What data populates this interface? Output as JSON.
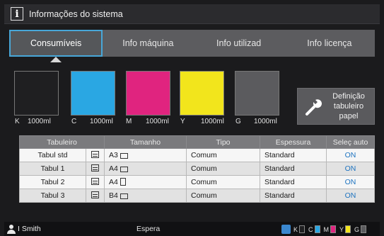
{
  "header": {
    "title": "Informações do sistema",
    "icon": "info-icon"
  },
  "tabs": [
    {
      "label": "Consumíveis",
      "active": true
    },
    {
      "label": "Info máquina",
      "active": false
    },
    {
      "label": "Info utilizad",
      "active": false
    },
    {
      "label": "Info licença",
      "active": false
    }
  ],
  "inks": [
    {
      "letter": "K",
      "amount": "1000ml",
      "color": "#1f1f21"
    },
    {
      "letter": "C",
      "amount": "1000ml",
      "color": "#2aa7e3"
    },
    {
      "letter": "M",
      "amount": "1000ml",
      "color": "#e0247f"
    },
    {
      "letter": "Y",
      "amount": "1000ml",
      "color": "#f2e51c"
    },
    {
      "letter": "G",
      "amount": "1000ml",
      "color": "#5b5b5e"
    }
  ],
  "tray_button": {
    "line1": "Definição",
    "line2": "tabuleiro",
    "line3": "papel",
    "icon": "wrench-icon"
  },
  "table": {
    "headers": [
      "Tabuleiro",
      "Tamanho",
      "Tipo",
      "Espessura",
      "Seleç auto"
    ],
    "rows": [
      {
        "tray": "Tabul std",
        "size": "A3",
        "orient": "landscape",
        "type": "Comum",
        "thickness": "Standard",
        "auto": "ON"
      },
      {
        "tray": "Tabul 1",
        "size": "A4",
        "orient": "landscape",
        "type": "Comum",
        "thickness": "Standard",
        "auto": "ON"
      },
      {
        "tray": "Tabul 2",
        "size": "A4",
        "orient": "portrait",
        "type": "Comum",
        "thickness": "Standard",
        "auto": "ON"
      },
      {
        "tray": "Tabul 3",
        "size": "B4",
        "orient": "landscape",
        "type": "Comum",
        "thickness": "Standard",
        "auto": "ON"
      }
    ]
  },
  "status": {
    "user": "I Smith",
    "state": "Espera",
    "mini_inks": [
      {
        "letter": "K",
        "color": "#1f1f21"
      },
      {
        "letter": "C",
        "color": "#2aa7e3"
      },
      {
        "letter": "M",
        "color": "#e0247f"
      },
      {
        "letter": "Y",
        "color": "#f2e51c"
      },
      {
        "letter": "G",
        "color": "#5b5b5e"
      }
    ]
  }
}
